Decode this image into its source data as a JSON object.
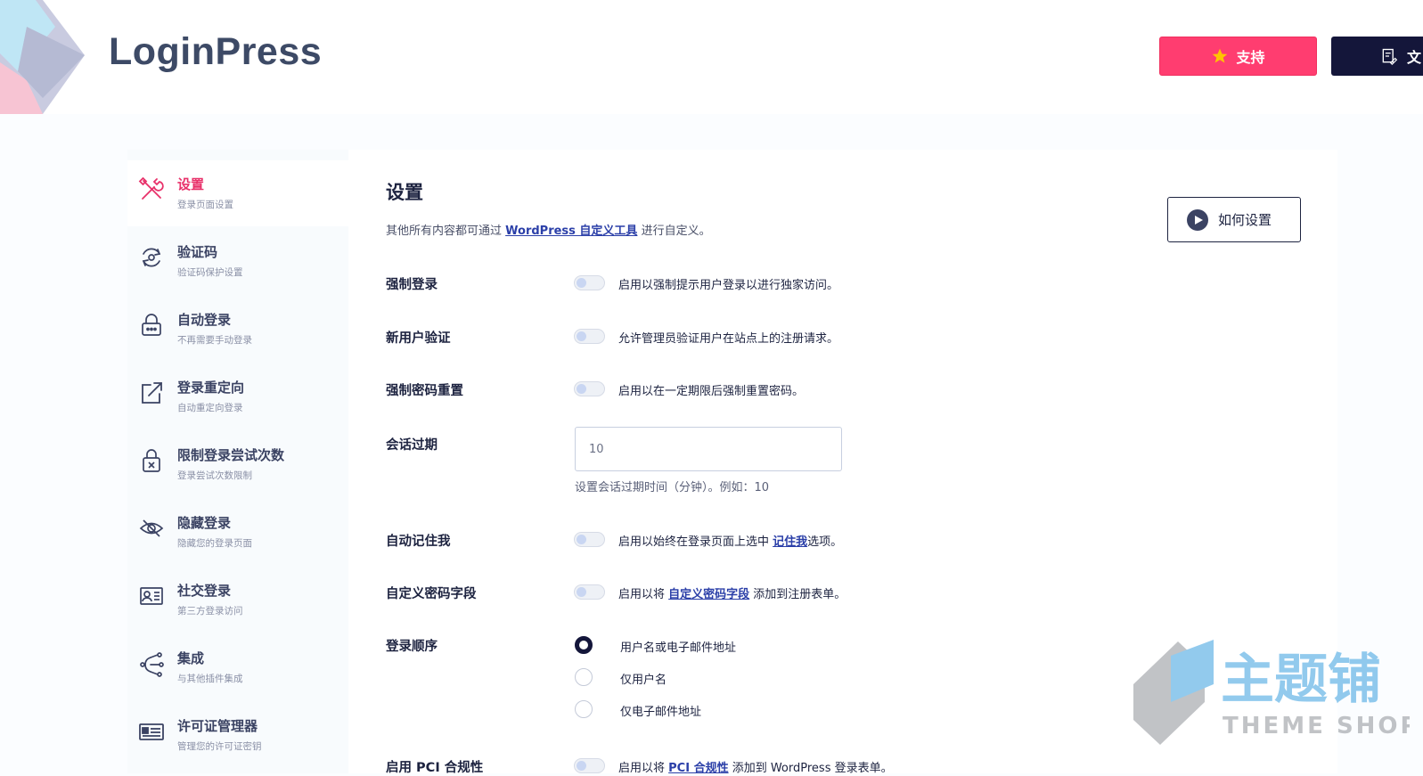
{
  "header": {
    "brand": "LoginPress",
    "support_label": "支持",
    "docs_label": "文"
  },
  "sidebar": {
    "items": [
      {
        "title": "设置",
        "subtitle": "登录页面设置",
        "icon": "tools-icon"
      },
      {
        "title": "验证码",
        "subtitle": "验证码保护设置",
        "icon": "captcha-icon"
      },
      {
        "title": "自动登录",
        "subtitle": "不再需要手动登录",
        "icon": "auto-login-icon"
      },
      {
        "title": "登录重定向",
        "subtitle": "自动重定向登录",
        "icon": "redirect-icon"
      },
      {
        "title": "限制登录尝试次数",
        "subtitle": "登录尝试次数限制",
        "icon": "lock-icon"
      },
      {
        "title": "隐藏登录",
        "subtitle": "隐藏您的登录页面",
        "icon": "eye-slash-icon"
      },
      {
        "title": "社交登录",
        "subtitle": "第三方登录访问",
        "icon": "id-card-icon"
      },
      {
        "title": "集成",
        "subtitle": "与其他插件集成",
        "icon": "integration-icon"
      },
      {
        "title": "许可证管理器",
        "subtitle": "管理您的许可证密钥",
        "icon": "license-icon"
      }
    ]
  },
  "main": {
    "title": "设置",
    "desc_before": "其他所有内容都可通过 ",
    "desc_link": "WordPress 自定义工具",
    "desc_after": " 进行自定义。",
    "howto_label": "如何设置",
    "force_login": {
      "label": "强制登录",
      "text": "启用以强制提示用户登录以进行独家访问。"
    },
    "new_user_verify": {
      "label": "新用户验证",
      "text": "允许管理员验证用户在站点上的注册请求。"
    },
    "force_pw_reset": {
      "label": "强制密码重置",
      "text": "启用以在一定期限后强制重置密码。"
    },
    "session_expiry": {
      "label": "会话过期",
      "value": "10",
      "hint": "设置会话过期时间（分钟）。例如：10"
    },
    "auto_remember": {
      "label": "自动记住我",
      "text_before": "启用以始终在登录页面上选中 ",
      "link": "记住我",
      "text_after": "选项。"
    },
    "custom_pw_field": {
      "label": "自定义密码字段",
      "text_before": "启用以将 ",
      "link": "自定义密码字段",
      "text_after": " 添加到注册表单。"
    },
    "login_order": {
      "label": "登录顺序",
      "options": [
        "用户名或电子邮件地址",
        "仅用户名",
        "仅电子邮件地址"
      ],
      "selected": 0
    },
    "pci": {
      "label": "启用 PCI 合规性",
      "text_before": "启用以将 ",
      "link": "PCI 合规性",
      "text_after": " 添加到 WordPress 登录表单。"
    }
  },
  "watermark": {
    "text_cn": "主题铺",
    "text_en": "THEME SHOP"
  },
  "colors": {
    "accent": "#e8316a",
    "support_bg": "#ff3d70",
    "dark": "#14163a",
    "link": "#2b3fa8"
  }
}
